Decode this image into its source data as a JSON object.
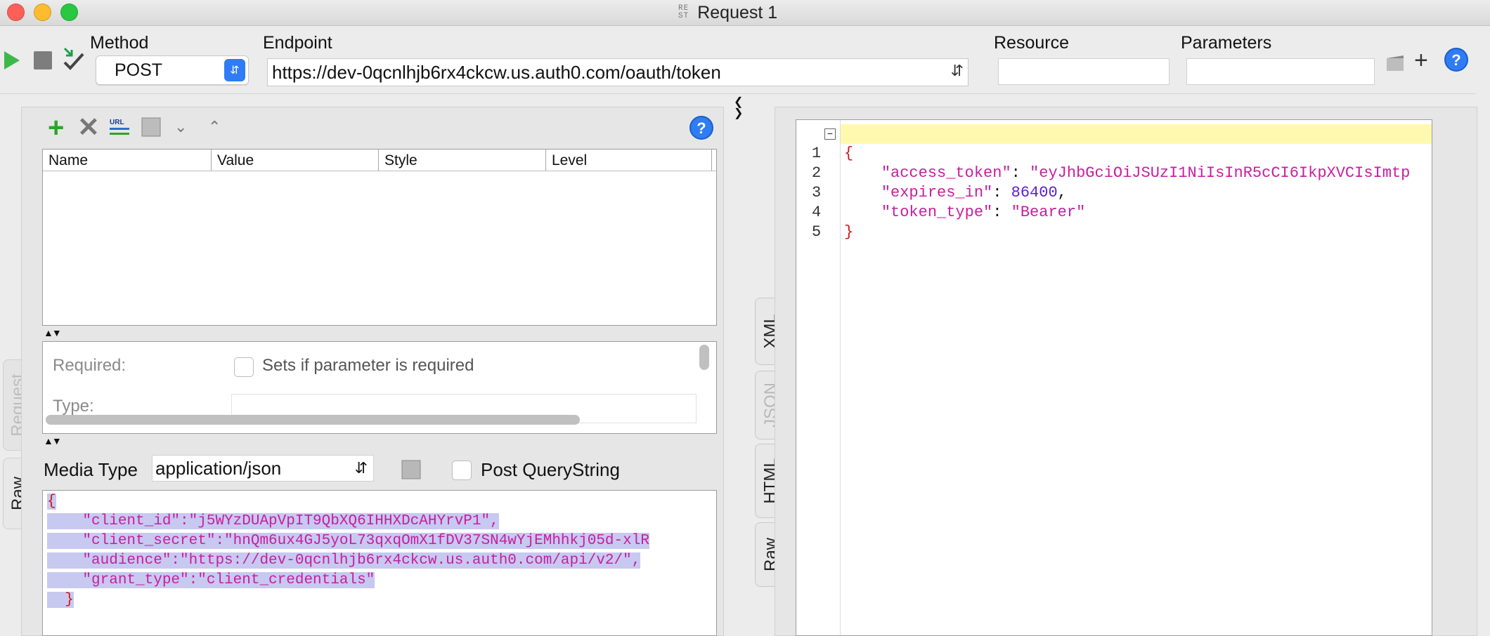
{
  "window": {
    "title": "Request 1",
    "type_icon_top": "RE",
    "type_icon_bottom": "ST"
  },
  "toolbar": {
    "method_label": "Method",
    "method_value": "POST",
    "endpoint_label": "Endpoint",
    "endpoint_value": "https://dev-0qcnlhjb6rx4ckcw.us.auth0.com/oauth/token",
    "resource_label": "Resource",
    "resource_value": "",
    "parameters_label": "Parameters",
    "parameters_value": ""
  },
  "params_table": {
    "columns": [
      "Name",
      "Value",
      "Style",
      "Level"
    ],
    "rows": []
  },
  "param_details": {
    "required_label": "Required:",
    "required_checkbox_label": "Sets if parameter is required",
    "type_label": "Type:"
  },
  "request_body": {
    "media_type_label": "Media Type",
    "media_type_value": "application/json",
    "post_querystring_label": "Post QueryString",
    "lines": [
      "{",
      "    \"client_id\":\"j5WYzDUApVpIT9QbXQ6IHHXDcAHYrvP1\",",
      "    \"client_secret\":\"hnQm6ux4GJ5yoL73qxqOmX1fDV37SN4wYjEMhhkj05d-xlR",
      "    \"audience\":\"https://dev-0qcnlhjb6rx4ckcw.us.auth0.com/api/v2/\",",
      "    \"grant_type\":\"client_credentials\"",
      "  }"
    ]
  },
  "left_tabs": [
    "Request",
    "Raw"
  ],
  "response_tabs": [
    "XML",
    "JSON",
    "HTML",
    "Raw"
  ],
  "response": {
    "line_numbers": [
      "1",
      "2",
      "3",
      "4",
      "5"
    ],
    "open_brace": "{",
    "close_brace": "}",
    "access_token_key": "\"access_token\"",
    "access_token_value": "\"eyJhbGciOiJSUzI1NiIsInR5cCI6IkpXVCIsImtp",
    "expires_in_key": "\"expires_in\"",
    "expires_in_value": "86400",
    "token_type_key": "\"token_type\"",
    "token_type_value": "\"Bearer\""
  },
  "colors": {
    "accent": "#2f7cf6",
    "run_green": "#3cb84a",
    "json_key": "#c81ea0",
    "json_number": "#5b1fd0",
    "brace_red": "#d01818",
    "selection": "#c7c9f0",
    "current_line": "#fff9b0"
  }
}
